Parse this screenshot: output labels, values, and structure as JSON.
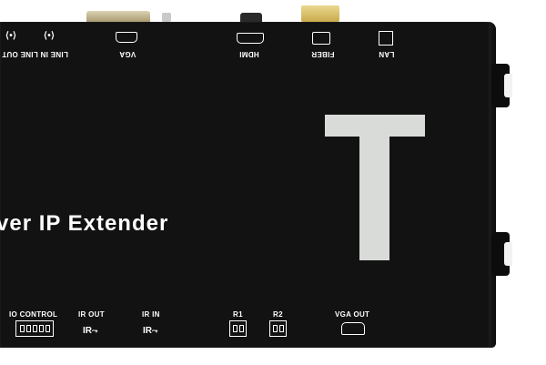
{
  "top_labels": {
    "line_in": "LINE IN",
    "line_out": "LINE OUT",
    "vga": "VGA",
    "hdmi": "HDMI",
    "fiber": "FIBER",
    "lan": "LAN"
  },
  "title": "ver IP Extender",
  "bottom_labels": {
    "io_control": "IO CONTROL",
    "ir_out": "IR OUT",
    "ir_in": "IR IN",
    "r1": "R1",
    "r2": "R2",
    "vga_out": "VGA OUT"
  },
  "ir_glyph": "IR",
  "logo_letter": "T",
  "colors": {
    "body": "#121212",
    "logo": "#d9dbd8",
    "text": "#ffffff"
  }
}
